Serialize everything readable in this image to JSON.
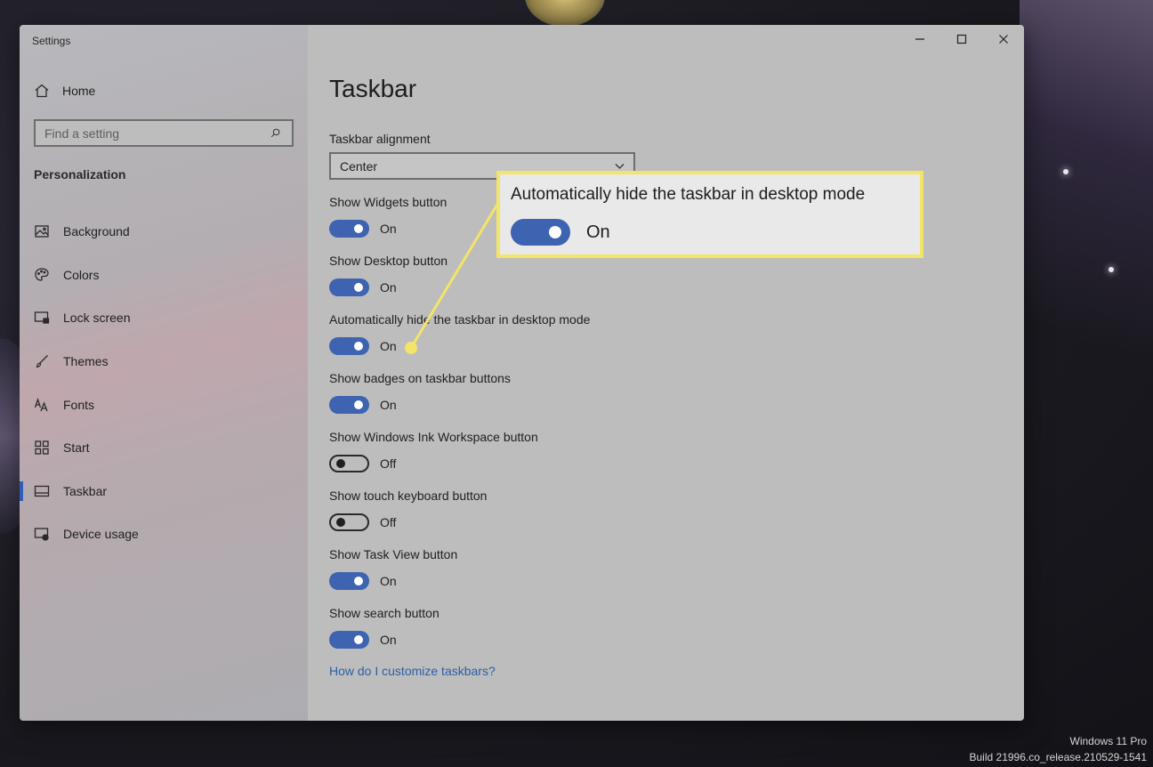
{
  "window": {
    "app_title": "Settings"
  },
  "sidebar": {
    "home_label": "Home",
    "search_placeholder": "Find a setting",
    "section_heading": "Personalization",
    "items": [
      {
        "label": "Background",
        "icon": "image-icon"
      },
      {
        "label": "Colors",
        "icon": "palette-icon"
      },
      {
        "label": "Lock screen",
        "icon": "lock-screen-icon"
      },
      {
        "label": "Themes",
        "icon": "brush-icon"
      },
      {
        "label": "Fonts",
        "icon": "font-icon"
      },
      {
        "label": "Start",
        "icon": "start-grid-icon"
      },
      {
        "label": "Taskbar",
        "icon": "taskbar-icon",
        "active": true
      },
      {
        "label": "Device usage",
        "icon": "device-usage-icon"
      }
    ]
  },
  "main": {
    "title": "Taskbar",
    "alignment": {
      "label": "Taskbar alignment",
      "value": "Center"
    },
    "settings": [
      {
        "label": "Show Widgets button",
        "state": "On"
      },
      {
        "label": "Show Desktop button",
        "state": "On"
      },
      {
        "label": "Automatically hide the taskbar in desktop mode",
        "state": "On"
      },
      {
        "label": "Show badges on taskbar buttons",
        "state": "On"
      },
      {
        "label": "Show Windows Ink Workspace button",
        "state": "Off"
      },
      {
        "label": "Show touch keyboard button",
        "state": "Off"
      },
      {
        "label": "Show Task View button",
        "state": "On"
      },
      {
        "label": "Show search button",
        "state": "On"
      }
    ],
    "help_link": "How do I customize taskbars?"
  },
  "callout": {
    "title": "Automatically hide the taskbar in desktop mode",
    "state": "On",
    "border_color": "#f3e46a"
  },
  "watermark": {
    "line1": "Windows 11 Pro",
    "line2": "Build 21996.co_release.210529-1541"
  },
  "colors": {
    "accent": "#3d63b1",
    "link": "#2a5fa6",
    "highlight": "#f3e46a"
  }
}
